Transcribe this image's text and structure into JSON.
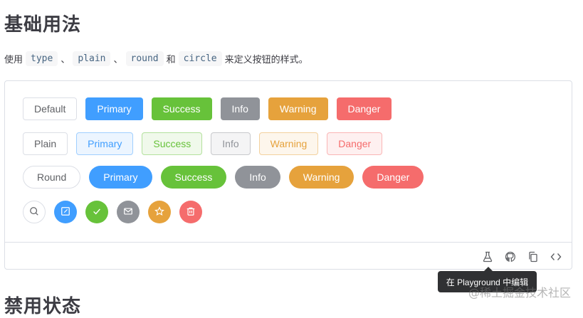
{
  "title": "基础用法",
  "description": {
    "prefix": "使用",
    "sep1": "、",
    "code1": "type",
    "code2": "plain",
    "sep2": "、",
    "code3": "round",
    "and": "和",
    "code4": "circle",
    "suffix": "来定义按钮的样式。"
  },
  "rows": {
    "default": {
      "default": "Default",
      "primary": "Primary",
      "success": "Success",
      "info": "Info",
      "warning": "Warning",
      "danger": "Danger"
    },
    "plain": {
      "default": "Plain",
      "primary": "Primary",
      "success": "Success",
      "info": "Info",
      "warning": "Warning",
      "danger": "Danger"
    },
    "round": {
      "default": "Round",
      "primary": "Primary",
      "success": "Success",
      "info": "Info",
      "warning": "Warning",
      "danger": "Danger"
    },
    "circle_icons": [
      "search-icon",
      "edit-icon",
      "check-icon",
      "message-icon",
      "star-icon",
      "delete-icon"
    ]
  },
  "footer_icons": [
    "playground-flask-icon",
    "github-icon",
    "copy-icon",
    "code-icon"
  ],
  "tooltip": "在 Playground 中编辑",
  "watermark": "@稀土掘金技术社区",
  "next_title": "禁用状态",
  "colors": {
    "primary": "#409eff",
    "success": "#67c23a",
    "info": "#909399",
    "warning": "#e6a23c",
    "danger": "#f56c6c"
  }
}
